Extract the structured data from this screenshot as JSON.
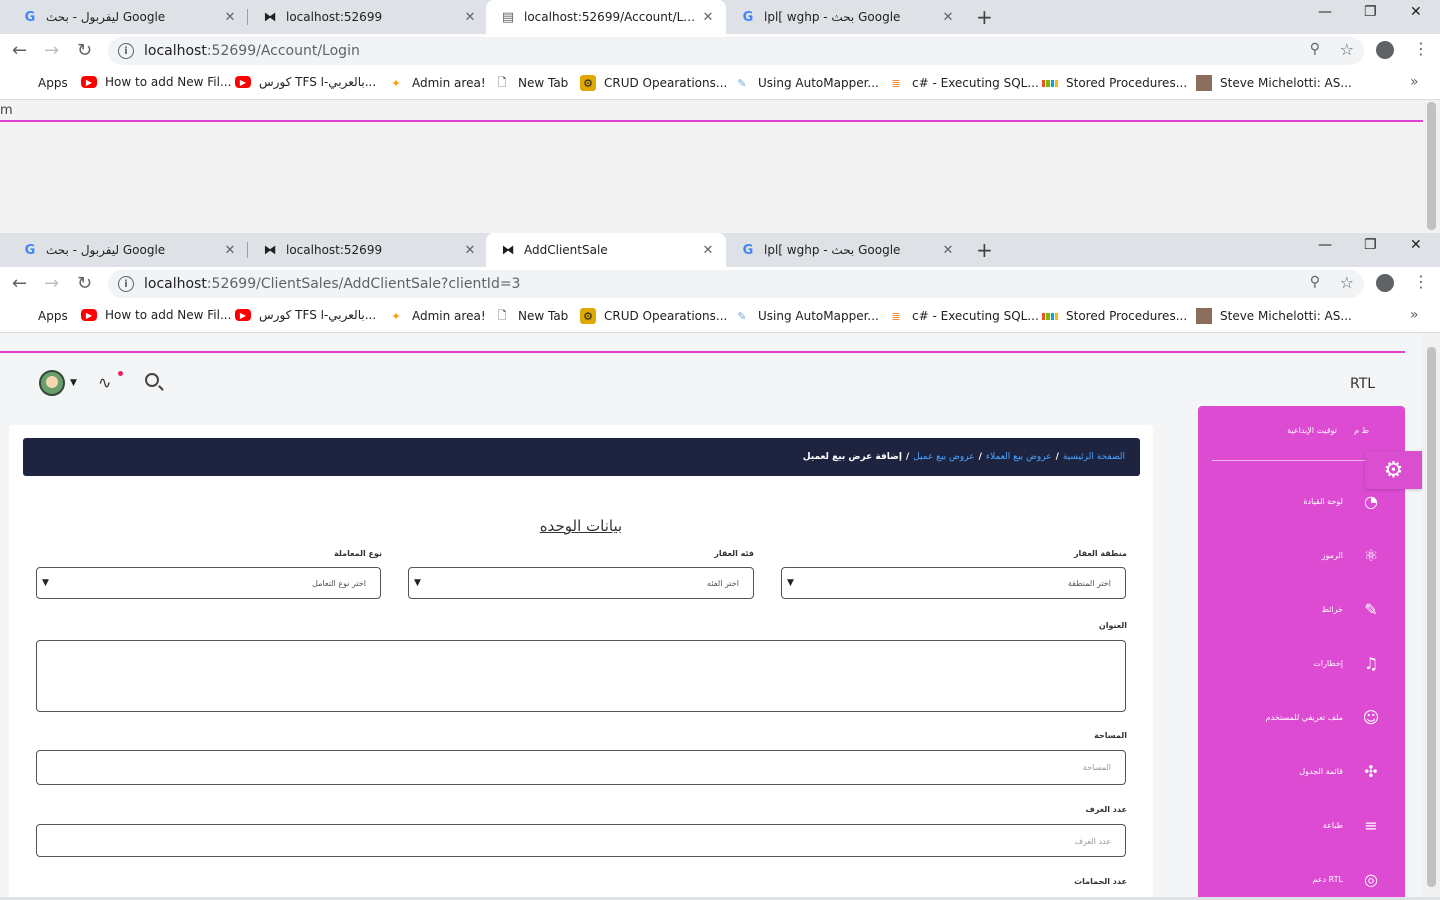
{
  "window1": {
    "tabs": [
      {
        "title": "ليفربول - بحث Google",
        "icon": "google-icon"
      },
      {
        "title": "localhost:52699",
        "icon": "bowtie-icon"
      },
      {
        "title": "localhost:52699/Account/Login",
        "icon": "document-icon"
      },
      {
        "title": "lpl[ wghp - بحث Google",
        "icon": "google-icon"
      }
    ],
    "url_host": "localhost",
    "url_path": ":52699/Account/Login",
    "page_text": "m"
  },
  "window2": {
    "tabs": [
      {
        "title": "ليفربول - بحث Google",
        "icon": "google-icon"
      },
      {
        "title": "localhost:52699",
        "icon": "bowtie-icon"
      },
      {
        "title": "AddClientSale",
        "icon": "bowtie-icon"
      },
      {
        "title": "lpl[ wghp - بحث Google",
        "icon": "google-icon"
      }
    ],
    "url_host": "localhost",
    "url_path": ":52699/ClientSales/AddClientSale?clientId=3"
  },
  "bookmarks": [
    {
      "label": "Apps"
    },
    {
      "label": "How to add New Fil..."
    },
    {
      "label": "كورس TFS بالعربي-ا..."
    },
    {
      "label": "Admin area!"
    },
    {
      "label": "New Tab"
    },
    {
      "label": "CRUD Opearations..."
    },
    {
      "label": "Using AutoMapper..."
    },
    {
      "label": "c# - Executing SQL..."
    },
    {
      "label": "Stored Procedures..."
    },
    {
      "label": "Steve Michelotti: AS..."
    }
  ],
  "app": {
    "rtl_label": "RTL",
    "breadcrumb": {
      "home": "الصفحة الرئيسية",
      "sales": "عروض بيع العملاء",
      "client": "عروض بيع عميل",
      "current": "إضافة عرض بيع لعميل",
      "sep": "/"
    },
    "section_title": "بيانات الوحده",
    "fields": {
      "region_label": "منطقة العقار",
      "region_value": "اختر المنطقة",
      "category_label": "فئه العقار",
      "category_value": "اختر الفئه",
      "deal_label": "نوع المعاملة",
      "deal_value": "اختر نوع التعامل",
      "address_label": "العنوان",
      "area_label": "المساحة",
      "area_placeholder": "المساحة",
      "rooms_label": "عدد الغرف",
      "rooms_placeholder": "عدد الغرف",
      "baths_label": "عدد الحمامات"
    },
    "sidebar": {
      "head_main": "توقيت الإبداعية",
      "head_short": "ط م",
      "items": [
        {
          "label": "لوحة القيادة",
          "icon": "pie-chart-icon"
        },
        {
          "label": "الرموز",
          "icon": "atom-icon"
        },
        {
          "label": "خرائط",
          "icon": "pin-icon"
        },
        {
          "label": "إخطارات",
          "icon": "bell-icon"
        },
        {
          "label": "ملف تعريفي للمستخدم",
          "icon": "user-icon"
        },
        {
          "label": "قائمة الجدول",
          "icon": "puzzle-icon"
        },
        {
          "label": "طباعة",
          "icon": "align-icon"
        },
        {
          "label": "دعم RTL",
          "icon": "globe-icon"
        }
      ]
    }
  }
}
